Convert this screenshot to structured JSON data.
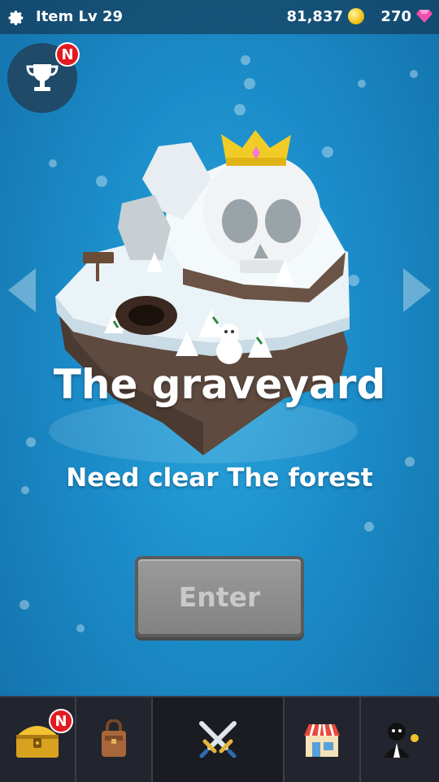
{
  "topbar": {
    "item_level_label": "Item Lv 29",
    "gold": "81,837",
    "gems": "270"
  },
  "trophy": {
    "badge": "N"
  },
  "stage": {
    "title": "The graveyard",
    "requirement": "Need clear The forest",
    "enter_label": "Enter"
  },
  "bottom_nav": {
    "chest_badge": "N",
    "items": [
      "treasure-chest",
      "backpack",
      "crossed-swords",
      "store",
      "butler"
    ]
  },
  "colors": {
    "background": "#1b8cc9",
    "badge": "#e21a22",
    "enter_disabled": "#8a8a8a",
    "bottom_bar": "#22252e"
  }
}
